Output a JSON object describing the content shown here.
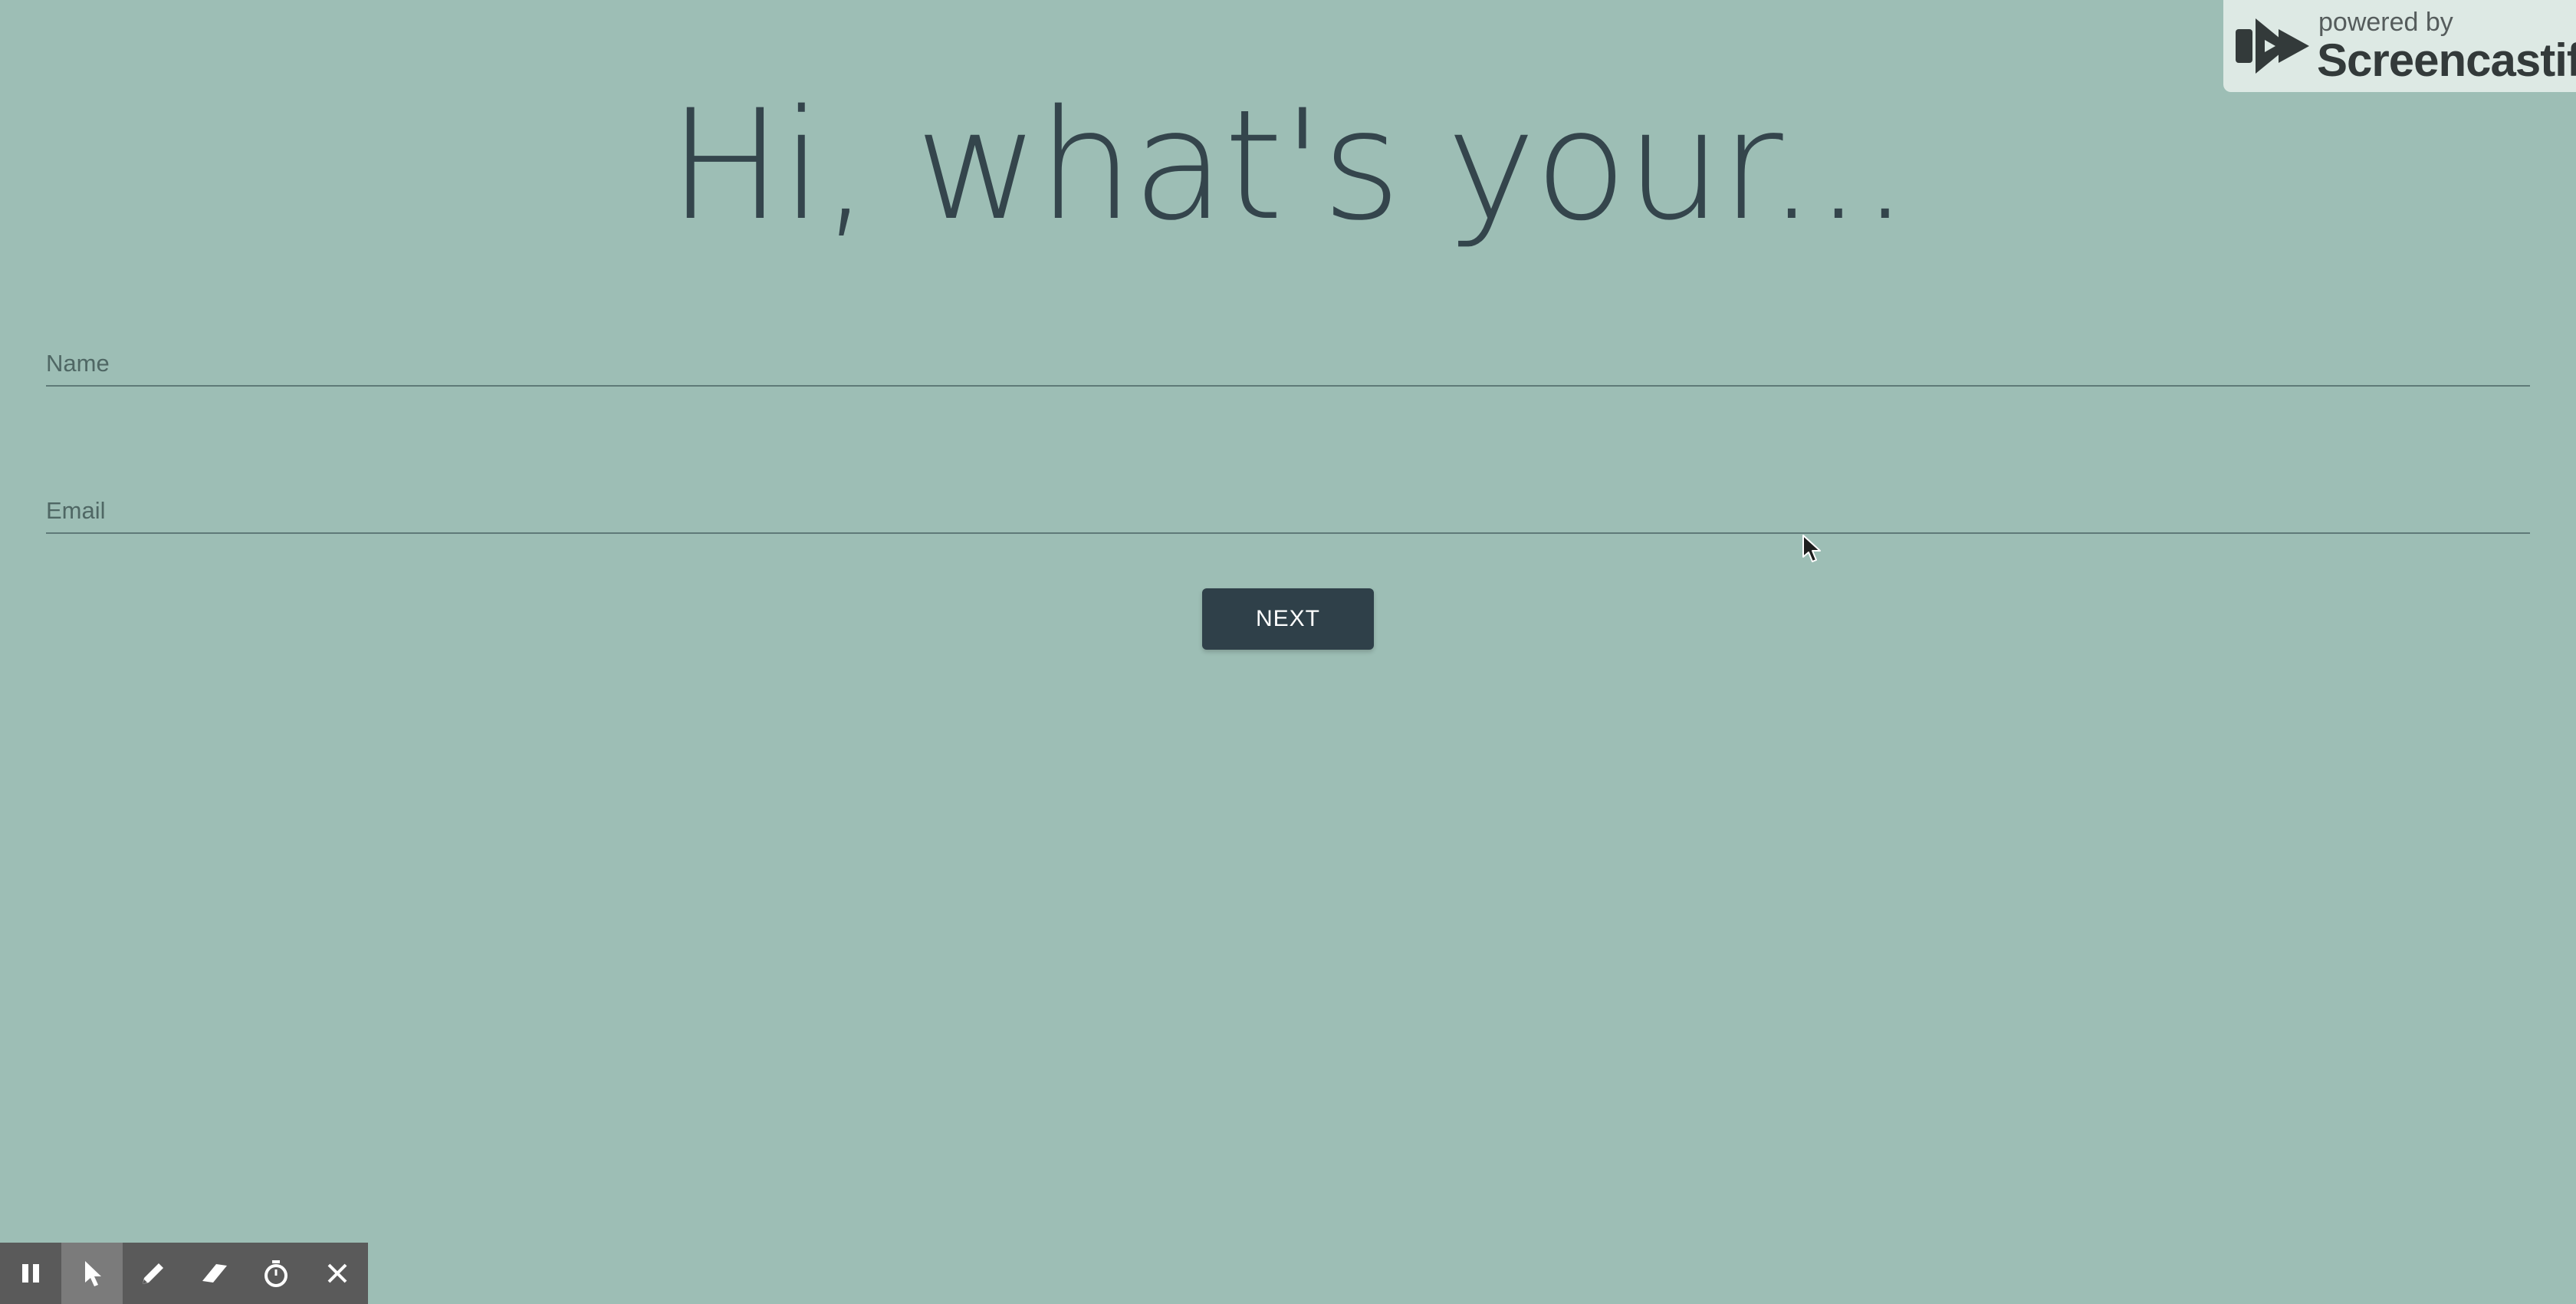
{
  "heading": "Hi, what's your...",
  "form": {
    "name_placeholder": "Name",
    "name_value": "",
    "email_placeholder": "Email",
    "email_value": "",
    "next_label": "NEXT"
  },
  "badge": {
    "powered_by": "powered by",
    "brand": "Screencastify"
  },
  "toolbar": {
    "tools": [
      "pause-icon",
      "pointer-icon",
      "pen-icon",
      "eraser-icon",
      "timer-icon",
      "close-icon"
    ],
    "active_tool": "pointer-icon"
  },
  "colors": {
    "background": "#9dbeb5",
    "heading_text": "#34454c",
    "button_bg": "#2f4049",
    "toolbar_bg": "#5a5a5a",
    "badge_bg": "#dde9e4"
  }
}
